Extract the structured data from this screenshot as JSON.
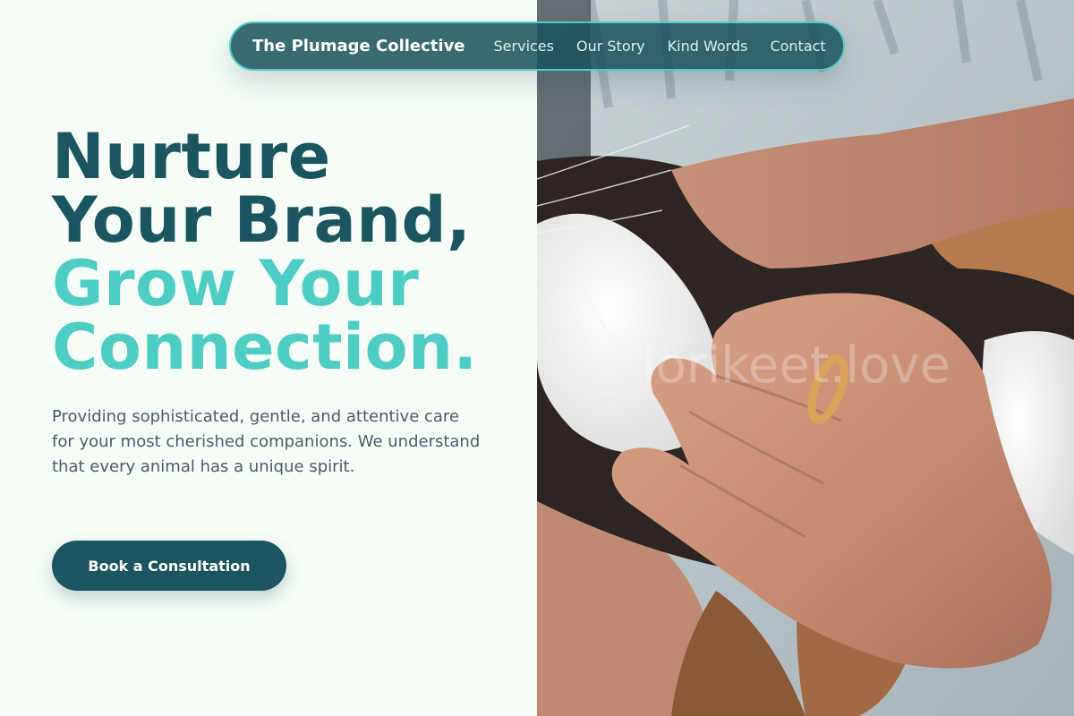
{
  "navbar": {
    "brand": "The Plumage Collective",
    "links": [
      "Services",
      "Our Story",
      "Kind Words",
      "Contact"
    ]
  },
  "hero": {
    "headline_line1": "Nurture",
    "headline_line2": "Your Brand,",
    "headline_line3": "Grow Your",
    "headline_line4": "Connection.",
    "description": "Providing sophisticated, gentle, and attentive care for your most cherished companions. We understand that every animal has a unique spirit.",
    "cta_label": "Book a Consultation",
    "photo_watermark": "lorikeet.love"
  },
  "colors": {
    "primary": "#1b5560",
    "accent": "#4ecdc4",
    "background": "#f6fdf7",
    "body_text": "#4a5a68"
  }
}
